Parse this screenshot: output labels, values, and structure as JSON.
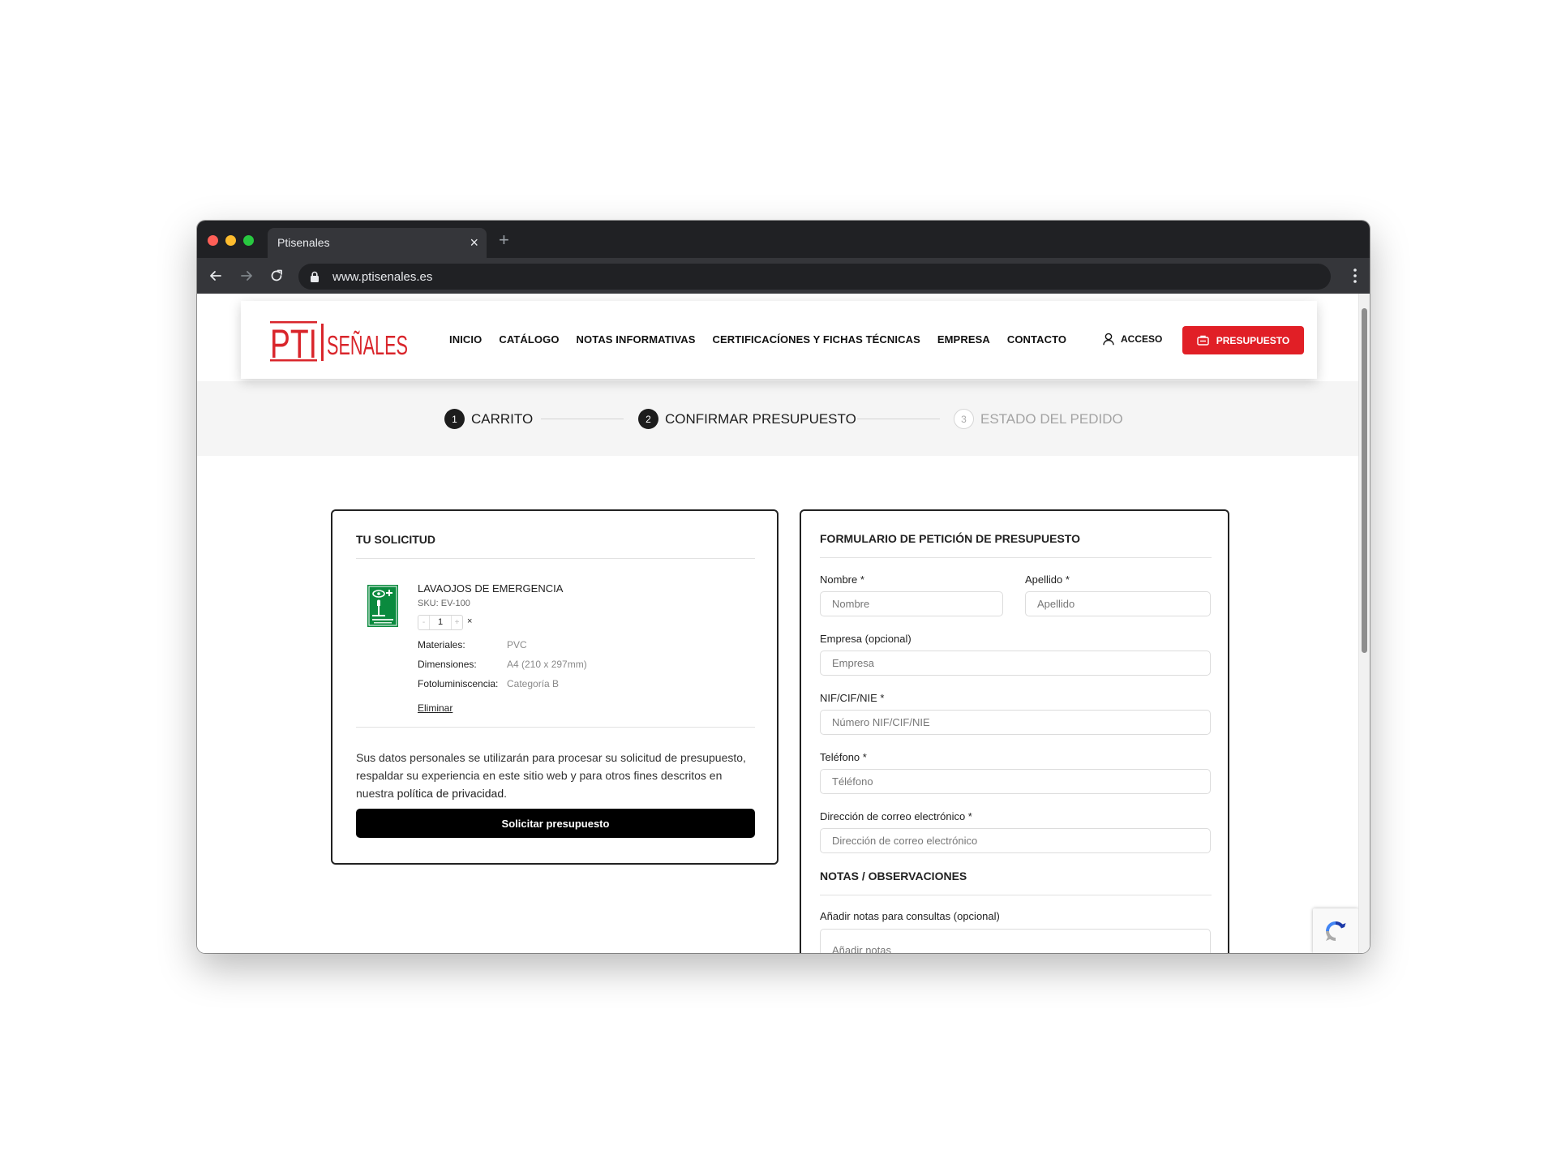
{
  "browser": {
    "tab_title": "Ptisenales",
    "tab_close": "×",
    "new_tab": "+",
    "url": "www.ptisenales.es"
  },
  "header": {
    "logo_text": "PTI SEÑALES",
    "nav": [
      "INICIO",
      "CATÁLOGO",
      "NOTAS INFORMATIVAS",
      "CERTIFICACÍONES Y FICHAS TÉCNICAS",
      "EMPRESA",
      "CONTACTO"
    ],
    "access_label": "ACCESO",
    "quote_button": "PRESUPUESTO",
    "brand_color": "#e11f26"
  },
  "steps": [
    {
      "number": "1",
      "label": "CARRITO",
      "active": true
    },
    {
      "number": "2",
      "label": "CONFIRMAR PRESUPUESTO",
      "active": true
    },
    {
      "number": "3",
      "label": "ESTADO DEL PEDIDO",
      "active": false
    }
  ],
  "request": {
    "title": "TU SOLICITUD",
    "product": {
      "name": "LAVAOJOS DE EMERGENCIA",
      "sku": "SKU: EV-100",
      "quantity": "1",
      "qty_minus": "-",
      "qty_plus": "+",
      "times": "×",
      "attributes": [
        {
          "label": "Materiales:",
          "value": "PVC"
        },
        {
          "label": "Dimensiones:",
          "value": "A4 (210 x 297mm)"
        },
        {
          "label": "Fotoluminiscencia:",
          "value": "Categoría B"
        }
      ],
      "remove": "Eliminar",
      "sign_color": "#0a8a3e"
    },
    "privacy_text": "Sus datos personales se utilizarán para procesar su solicitud de presupuesto, respaldar su experiencia en este sitio web y para otros fines descritos en nuestra",
    "privacy_link": "política de privacidad",
    "privacy_end": ".",
    "submit": "Solicitar presupuesto"
  },
  "form": {
    "title": "FORMULARIO DE PETICIÓN DE PRESUPUESTO",
    "fields": {
      "nombre": {
        "label": "Nombre *",
        "placeholder": "Nombre"
      },
      "apellido": {
        "label": "Apellido *",
        "placeholder": "Apellido"
      },
      "empresa": {
        "label": "Empresa (opcional)",
        "placeholder": "Empresa"
      },
      "nif": {
        "label": "NIF/CIF/NIE *",
        "placeholder": "Número NIF/CIF/NIE"
      },
      "telefono": {
        "label": "Teléfono *",
        "placeholder": "Téléfono"
      },
      "email": {
        "label": "Dirección de correo electrónico *",
        "placeholder": "Dirección de correo electrónico"
      }
    },
    "notes_title": "NOTAS / OBSERVACIONES",
    "notes": {
      "label": "Añadir notas para consultas (opcional)",
      "placeholder": "Añadir notas"
    }
  }
}
